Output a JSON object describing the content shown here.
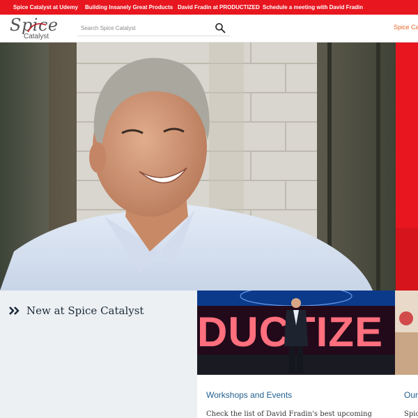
{
  "topbar": {
    "links": [
      {
        "label": "Spice Catalyst at Udemy"
      },
      {
        "label": "Building Insanely Great Products"
      },
      {
        "label": "David Fradin at PRODUCTIZED"
      },
      {
        "label": "Schedule a meeting with David Fradin"
      }
    ]
  },
  "header": {
    "logo_word": "Spice",
    "logo_sub": "Catalyst",
    "search_placeholder": "Search Spice Catalyst",
    "right_link": "Spice Catalyst"
  },
  "hero": {
    "icons": {
      "photo": "portrait-photo"
    }
  },
  "section": {
    "heading": "New at Spice Catalyst",
    "heading_icon": "double-chevron-right-icon"
  },
  "cards": [
    {
      "image_word": "DUCTIZE",
      "title": "Workshops and Events",
      "description": "Check the list of David Fradin's best upcoming"
    },
    {
      "title": "Our",
      "description": "Spic"
    }
  ],
  "colors": {
    "brand_red": "#e8161f",
    "link_blue": "#1f5e8f",
    "heading_navy": "#1d2b3a",
    "accent_orange": "#e8662a"
  }
}
